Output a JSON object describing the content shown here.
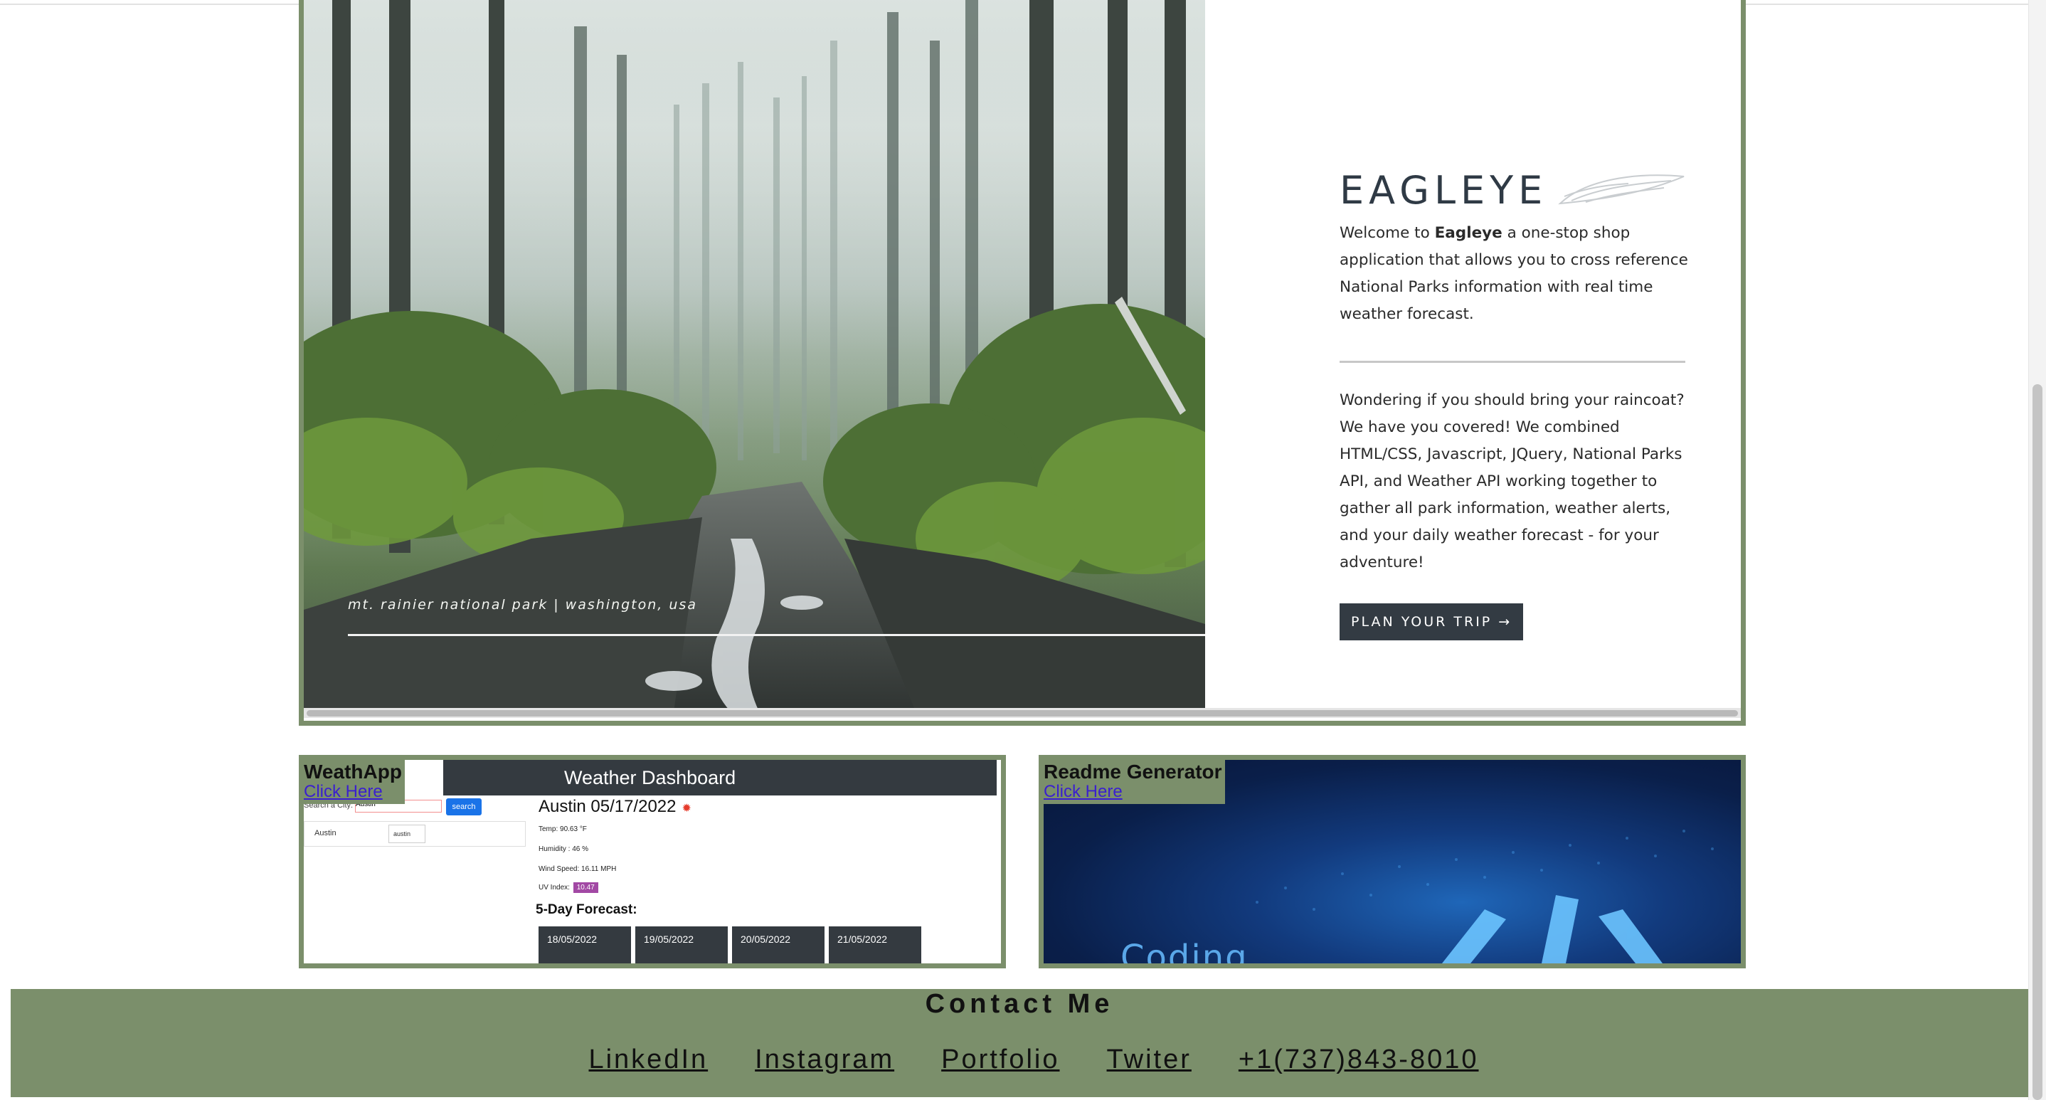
{
  "hero": {
    "photo_caption": "mt. rainier national park | washington, usa",
    "brand": "EAGLEYE",
    "intro_before": "Welcome to ",
    "intro_bold": "Eagleye",
    "intro_after": " a one-stop shop application that allows you to cross reference National Parks information with real time weather forecast.",
    "description": "Wondering if you should bring your raincoat? We have you covered! We combined HTML/CSS, Javascript, JQuery, National Parks API, and Weather API working together to gather all park information, weather alerts, and your daily weather forecast - for your adventure!",
    "cta_label": "PLAN YOUR TRIP →"
  },
  "projects": {
    "weathapp": {
      "title": "WeathApp",
      "link": "Click Here",
      "preview": {
        "header": "Weather Dashboard",
        "search_label": "Search a City:",
        "search_value": "Austin",
        "search_button": "search",
        "history_city": "Austin",
        "history_city_2": "austin",
        "city_date": "Austin 05/17/2022",
        "temp": "Temp: 90.63 °F",
        "humidity": "Humidity : 46 %",
        "wind": "Wind Speed: 16.11 MPH",
        "uv_label": "UV Index:",
        "uv_value": "10.47",
        "forecast_title": "5-Day Forecast:",
        "forecast_dates": [
          "18/05/2022",
          "19/05/2022",
          "20/05/2022",
          "21/05/2022"
        ]
      }
    },
    "readme": {
      "title": "Readme Generator",
      "link": "Click Here",
      "image_word": "Coding"
    }
  },
  "footer": {
    "title": "Contact Me",
    "links": [
      "LinkedIn",
      "Instagram",
      "Portfolio",
      "Twiter",
      "+1(737)843-8010"
    ]
  },
  "colors": {
    "accent_green": "#7b8f6b",
    "dark_button": "#333b43",
    "link_blue": "#3a1fcf"
  },
  "icons": [
    "wing-icon",
    "sun-icon",
    "cloud-icon"
  ]
}
